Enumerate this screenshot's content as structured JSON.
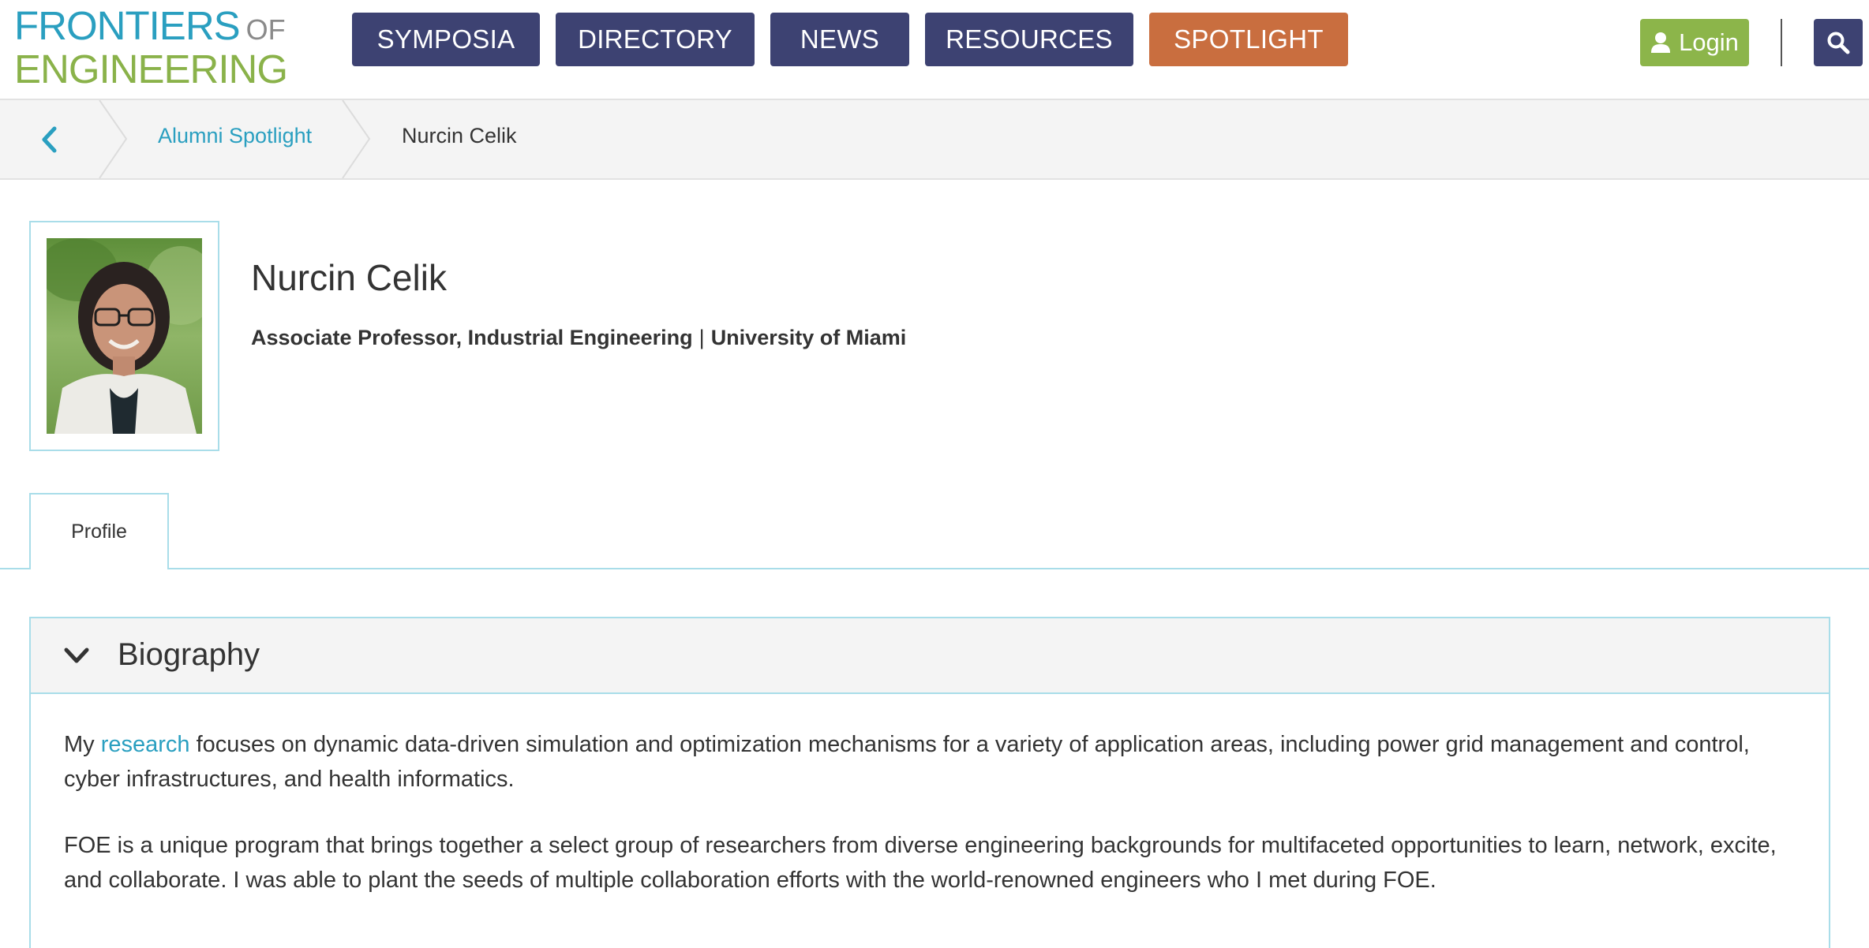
{
  "colors": {
    "nav_bg": "#3d4272",
    "spotlight_bg": "#c96e3f",
    "login_bg": "#8cb54a",
    "link": "#2a9fc0",
    "accent_border": "#a9dde9"
  },
  "logo": {
    "line1": "FRONTIERS",
    "of": "OF",
    "line2": "ENGINEERING"
  },
  "nav": {
    "items": [
      {
        "label": "SYMPOSIA"
      },
      {
        "label": "DIRECTORY"
      },
      {
        "label": "NEWS"
      },
      {
        "label": "RESOURCES"
      },
      {
        "label": "SPOTLIGHT"
      }
    ],
    "login_label": "Login",
    "login_icon": "user-icon",
    "search_icon": "search-icon"
  },
  "breadcrumb": {
    "back_icon": "chevron-left-icon",
    "items": [
      {
        "label": "Alumni Spotlight"
      },
      {
        "label": "Nurcin Celik"
      }
    ]
  },
  "profile": {
    "name": "Nurcin Celik",
    "position": "Associate Professor, Industrial Engineering",
    "separator": "|",
    "institution": "University of Miami"
  },
  "tabs": [
    {
      "label": "Profile",
      "active": true
    }
  ],
  "biography": {
    "title": "Biography",
    "toggle_icon": "chevron-down-icon",
    "p1_prefix": "My",
    "p1_link": "research",
    "p1_rest": "focuses on dynamic data-driven simulation and optimization mechanisms for a variety of application areas, including power grid management and control, cyber infrastructures, and health informatics.",
    "p2": "FOE is a unique program that brings together a select group of researchers from diverse engineering backgrounds for multifaceted opportunities to learn, network, excite, and collaborate. I was able to plant the seeds of multiple collaboration efforts with the world-renowned engineers who I met during FOE."
  }
}
